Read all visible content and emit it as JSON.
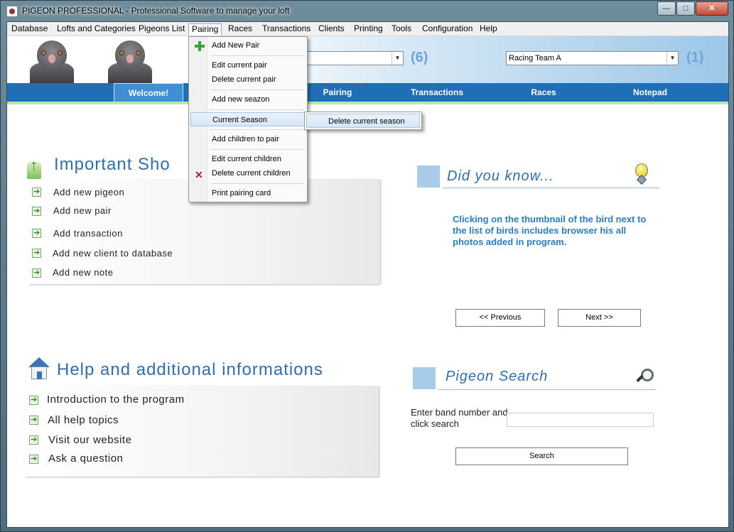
{
  "window": {
    "title": "PIGEON PROFESSIONAL - Professional Software to manage your loft",
    "minimize": "—",
    "maximize": "□",
    "close": "✕"
  },
  "menubar": {
    "items": [
      "Database",
      "Lofts and Categories",
      "Pigeons List",
      "Pairing",
      "Races",
      "Transactions",
      "Clients",
      "Printing",
      "Tools",
      "Configuration",
      "Help"
    ]
  },
  "header": {
    "team_combo_value": "Racing Team A",
    "first_count": "(6)",
    "team_count": "(1)"
  },
  "tabs": [
    "Welcome!",
    "Pairing",
    "Transactions",
    "Races",
    "Notepad"
  ],
  "pairing_menu": {
    "add_new_pair": "Add New Pair",
    "edit_current_pair": "Edit current pair",
    "delete_current_pair": "Delete current pair",
    "add_new_seazon": "Add new seazon",
    "current_season": "Current Season",
    "add_children": "Add children to pair",
    "edit_current_children": "Edit current children",
    "delete_current_children": "Delete current children",
    "print_pairing_card": "Print pairing card"
  },
  "current_season_submenu": {
    "delete_current_season": "Delete current season"
  },
  "shortcuts": {
    "title": "Important Sho",
    "items": [
      "Add new pigeon",
      "Add new pair",
      "Add transaction",
      "Add new client to database",
      "Add new note"
    ]
  },
  "help": {
    "title": "Help and additional informations",
    "items": [
      "Introduction to the program",
      "All help topics",
      "Visit our website",
      "Ask a question"
    ]
  },
  "did_you_know": {
    "title": "Did you know...",
    "tip": "Clicking on the thumbnail of the bird next to the list of birds includes browser his all photos added in program.",
    "previous": "<< Previous",
    "next": "Next >>"
  },
  "pigeon_search": {
    "title": "Pigeon Search",
    "label": "Enter band number and click search",
    "input_value": "",
    "button": "Search"
  }
}
